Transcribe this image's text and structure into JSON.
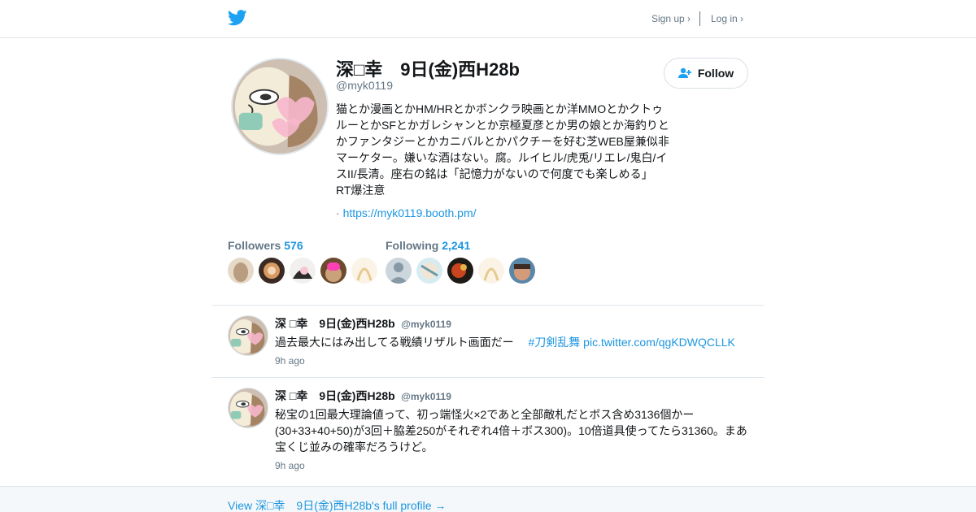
{
  "header": {
    "logo_icon": "twitter-bird-icon",
    "signup_label": "Sign up ›",
    "login_label": "Log in ›"
  },
  "profile": {
    "name": "深□幸　9日(金)西H28b",
    "handle": "@myk0119",
    "bio": "猫とか漫画とかHM/HRとかボンクラ映画とか洋MMOとかクトゥルーとかSFとかガレシャンとか京極夏彦とか男の娘とか海釣りとかファンタジーとかカニバルとかパクチーを好む芝WEB屋兼似非マーケター。嫌いな酒はない。腐。ルイヒル/虎兎/リエレ/鬼白/イスII/長清。座右の銘は「記憶力がないので何度でも楽しめる」　RT爆注意",
    "url_prefix": "·",
    "url": "https://myk0119.booth.pm/",
    "follow_label": "Follow"
  },
  "stats": {
    "followers_label": "Followers",
    "followers_count": "576",
    "following_label": "Following",
    "following_count": "2,241"
  },
  "tweets": [
    {
      "name": "深 □幸　9日(金)西H28b",
      "handle": "@myk0119",
      "text": "過去最大にはみ出してる戦績リザルト画面だー　",
      "hashtag": "#刀剣乱舞",
      "media_link": "pic.twitter.com/qgKDWQCLLK",
      "time": "9h ago"
    },
    {
      "name": "深 □幸　9日(金)西H28b",
      "handle": "@myk0119",
      "text": "秘宝の1回最大理論値って、初っ端怪火×2であと全部敵札だとボス含め3136個かー(30+33+40+50)が3回＋脇差250がそれぞれ4倍＋ボス300)。10倍道具使ってたら31360。まあ宝くじ並みの確率だろうけど。",
      "time": "9h ago"
    }
  ],
  "footer": {
    "link_label": "View 深□幸　9日(金)西H28b's full profile →"
  },
  "colors": {
    "brand": "#1da1f2",
    "link": "#1b95e0",
    "muted": "#657786",
    "border": "#e1e8ed",
    "footer_bg": "#f5f8fa"
  }
}
